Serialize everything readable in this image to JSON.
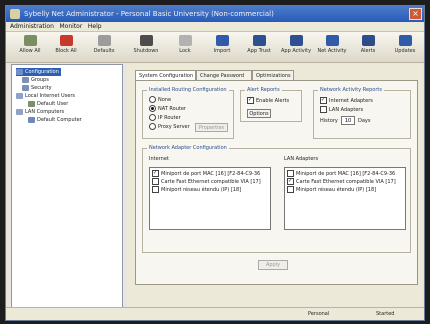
{
  "window": {
    "title": "Sybelly Net Administrator - Personal Basic University (Non-commercial)",
    "close_glyph": "×"
  },
  "menu": {
    "items": [
      "Administration",
      "Monitor",
      "Help"
    ]
  },
  "toolbar": {
    "items": [
      {
        "label": "Allow All",
        "icon": "allow-icon",
        "color": "#7a8f61"
      },
      {
        "label": "Block All",
        "icon": "block-icon",
        "color": "#c63a2d"
      },
      {
        "label": "Defaults",
        "icon": "defaults-icon",
        "color": "#9c9c9c"
      },
      {
        "label": "Shutdown",
        "icon": "shutdown-icon",
        "color": "#4c4c4c"
      },
      {
        "label": "Lock",
        "icon": "lock-icon",
        "color": "#b2b2b2"
      },
      {
        "label": "Import",
        "icon": "import-icon",
        "color": "#315aa8"
      },
      {
        "label": "App Trust",
        "icon": "apptrust-icon",
        "color": "#2f4f93"
      },
      {
        "label": "App Activity",
        "icon": "appactivity-icon",
        "color": "#2f4f93"
      },
      {
        "label": "Net Activity",
        "icon": "netactivity-icon",
        "color": "#315aa8"
      },
      {
        "label": "Alerts",
        "icon": "alerts-icon",
        "color": "#2d4d8a"
      },
      {
        "label": "Updates",
        "icon": "updates-icon",
        "color": "#315aa8"
      }
    ]
  },
  "sidebar": {
    "items": [
      {
        "label": "Configuration",
        "icon": "configuration-icon",
        "selected": true
      },
      {
        "label": "Groups",
        "icon": "groups-icon"
      },
      {
        "label": "Security",
        "icon": "security-icon"
      },
      {
        "label": "Local Internet Users",
        "icon": "users-icon"
      },
      {
        "label": "Default User",
        "icon": "user-icon"
      },
      {
        "label": "LAN Computers",
        "icon": "lan-icon"
      },
      {
        "label": "Default Computer",
        "icon": "computer-icon"
      }
    ]
  },
  "tabs": [
    {
      "label": "System Configuration",
      "active": true
    },
    {
      "label": "Change Password",
      "active": false
    },
    {
      "label": "Optimizations",
      "active": false
    }
  ],
  "routing": {
    "title": "Installed Routing Configuration",
    "options": [
      {
        "label": "None",
        "selected": false
      },
      {
        "label": "NAT Router",
        "selected": true
      },
      {
        "label": "IP Router",
        "selected": false
      },
      {
        "label": "Proxy Server",
        "selected": false
      }
    ],
    "proxy_button": "Properties"
  },
  "alerts": {
    "title": "Alert Reports",
    "enable_label": "Enable Alerts",
    "enabled": true,
    "options_button": "Options"
  },
  "network_reports": {
    "title": "Network Activity Reports",
    "internet_label": "Internet Adapters",
    "internet_checked": true,
    "lan_label": "LAN Adapters",
    "lan_checked": false,
    "history_label": "History",
    "history_value": "10",
    "days_label": "Days"
  },
  "adapter": {
    "title": "Network Adapter Configuration",
    "internet_title": "Internet",
    "lan_title": "LAN Adapters",
    "internet_items": [
      {
        "label": "Miniport de port MAC [16] [F2-84-C9-36",
        "checked": true
      },
      {
        "label": "Carte Fast Ethernet compatible VIA [17]",
        "checked": false
      },
      {
        "label": "Miniport réseau étendu (IP) [18]",
        "checked": false
      }
    ],
    "lan_items": [
      {
        "label": "Miniport de port MAC [16] [F2-84-C9-36",
        "checked": false
      },
      {
        "label": "Carte Fast Ethernet compatible VIA [17]",
        "checked": true
      },
      {
        "label": "Miniport réseau étendu (IP) [18]",
        "checked": false
      }
    ]
  },
  "apply_button": "Apply",
  "status": {
    "mode": "Personal",
    "state": "Started"
  }
}
